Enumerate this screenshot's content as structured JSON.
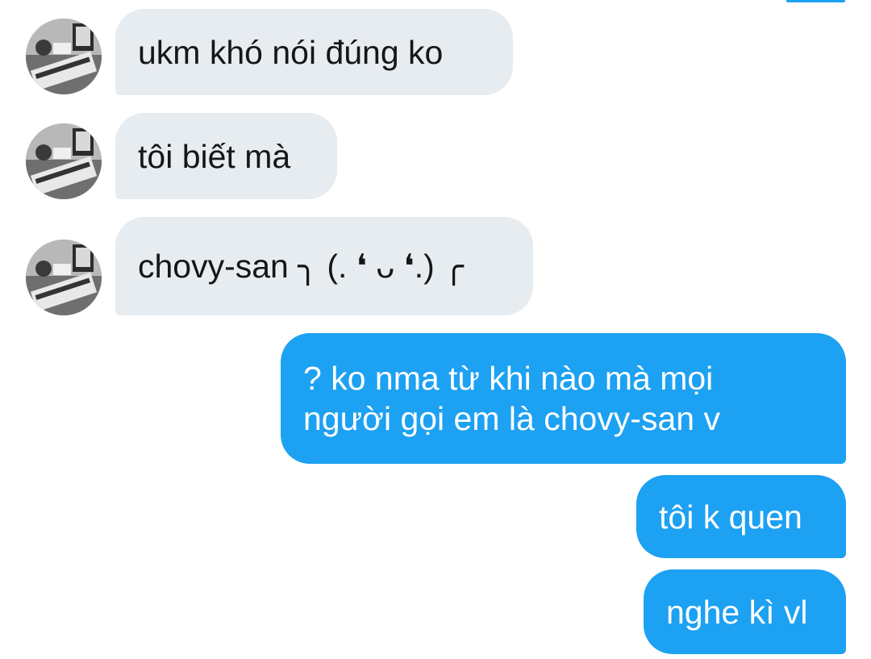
{
  "conversation": {
    "incoming": [
      {
        "text": "ukm khó nói đúng ko"
      },
      {
        "text": "tôi biết mà"
      },
      {
        "text": "chovy-san ╮ (. ❛ ᴗ ❛.) ╭"
      }
    ],
    "outgoing": [
      {
        "lines": [
          "? ko nma từ khi nào mà mọi",
          "người gọi em là chovy-san v"
        ]
      },
      {
        "text": "tôi k quen"
      },
      {
        "text": "nghe kì vl"
      }
    ]
  },
  "colors": {
    "incoming_bubble": "#e6ecf0",
    "outgoing_bubble": "#1da1f2",
    "incoming_text": "#14171a",
    "outgoing_text": "#ffffff"
  },
  "icons": {
    "avatar": "contact-avatar-photo"
  }
}
